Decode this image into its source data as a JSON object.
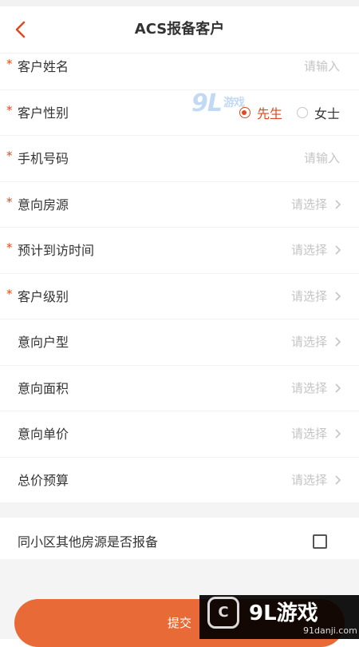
{
  "header": {
    "title": "ACS报备客户",
    "back_icon": "chevron-left-icon",
    "accent": "#e0491e"
  },
  "form": {
    "required_mark": "*",
    "name": {
      "label": "客户姓名",
      "placeholder": "请输入"
    },
    "gender": {
      "label": "客户性别",
      "options": [
        "先生",
        "女士"
      ],
      "selected": "先生"
    },
    "phone": {
      "label": "手机号码",
      "placeholder": "请输入"
    },
    "property": {
      "label": "意向房源",
      "value": "请选择"
    },
    "visit_time": {
      "label": "预计到访时间",
      "value": "请选择"
    },
    "level": {
      "label": "客户级别",
      "value": "请选择"
    },
    "layout": {
      "label": "意向户型",
      "value": "请选择"
    },
    "area": {
      "label": "意向面积",
      "value": "请选择"
    },
    "unit_price": {
      "label": "意向单价",
      "value": "请选择"
    },
    "budget": {
      "label": "总价预算",
      "value": "请选择"
    }
  },
  "check": {
    "label": "同小区其他房源是否报备",
    "checked": false
  },
  "submit": {
    "label": "提交",
    "color": "#e86a37"
  },
  "watermarks": {
    "center_main": "9L",
    "center_sub": "游戏",
    "corner_logo": "C",
    "corner_brand": "9L游戏",
    "corner_url": "91danji.com"
  }
}
